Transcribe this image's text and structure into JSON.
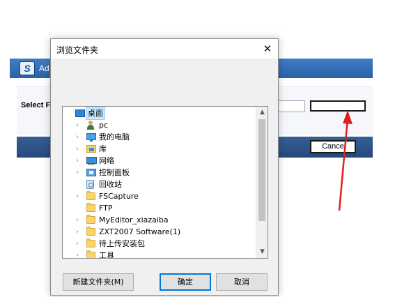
{
  "background_app": {
    "title": "Ad",
    "logo_letter": "S",
    "select_label": "Select Fi",
    "cancel_label": "Cance"
  },
  "dialog": {
    "title": "浏览文件夹",
    "close_glyph": "✕",
    "tree_items": [
      {
        "label": "桌面",
        "icon": "desktop-icon",
        "expandable": false,
        "selected": true,
        "indent": 0
      },
      {
        "label": "pc",
        "icon": "user-icon",
        "expandable": true,
        "selected": false,
        "indent": 1
      },
      {
        "label": "我的电脑",
        "icon": "computer-icon",
        "expandable": true,
        "selected": false,
        "indent": 1
      },
      {
        "label": "库",
        "icon": "library-icon",
        "expandable": true,
        "selected": false,
        "indent": 1
      },
      {
        "label": "网络",
        "icon": "network-icon",
        "expandable": true,
        "selected": false,
        "indent": 1
      },
      {
        "label": "控制面板",
        "icon": "control-panel-icon",
        "expandable": true,
        "selected": false,
        "indent": 1
      },
      {
        "label": "回收站",
        "icon": "recycle-bin-icon",
        "expandable": false,
        "selected": false,
        "indent": 1
      },
      {
        "label": "FSCapture",
        "icon": "folder-icon",
        "expandable": true,
        "selected": false,
        "indent": 1
      },
      {
        "label": "FTP",
        "icon": "folder-icon",
        "expandable": false,
        "selected": false,
        "indent": 1
      },
      {
        "label": "MyEditor_xiazaiba",
        "icon": "folder-icon",
        "expandable": true,
        "selected": false,
        "indent": 1
      },
      {
        "label": "ZXT2007 Software(1)",
        "icon": "folder-icon",
        "expandable": true,
        "selected": false,
        "indent": 1
      },
      {
        "label": "待上传安装包",
        "icon": "folder-icon",
        "expandable": true,
        "selected": false,
        "indent": 1
      },
      {
        "label": "工具",
        "icon": "folder-icon",
        "expandable": true,
        "selected": false,
        "indent": 1
      }
    ],
    "buttons": {
      "new_folder": "新建文件夹(M)",
      "ok": "确定",
      "cancel": "取消"
    }
  },
  "annotation": {
    "arrow_color": "#e02020"
  }
}
